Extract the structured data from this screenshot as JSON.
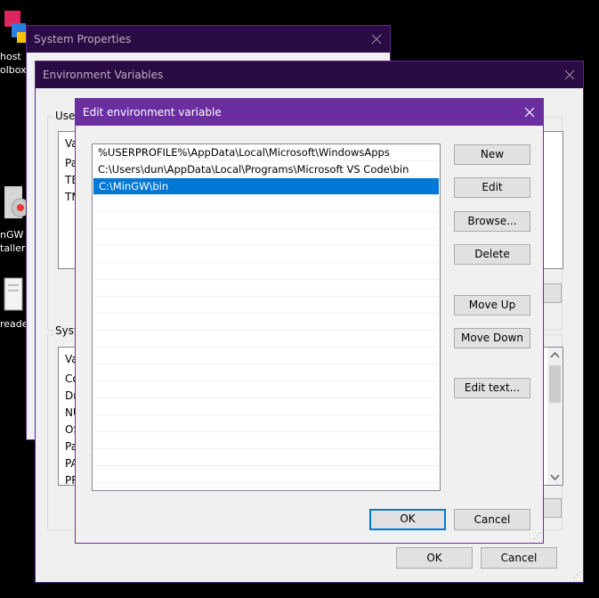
{
  "desktop": {
    "icons": [
      {
        "name": "ghost-toolbox",
        "lines": [
          "host",
          "olbox"
        ]
      },
      {
        "name": "mingw-installer",
        "lines": [
          "nGW",
          "taller"
        ]
      },
      {
        "name": "reader",
        "lines": [
          "reader"
        ]
      }
    ]
  },
  "system_properties": {
    "title": "System Properties"
  },
  "env_vars": {
    "title": "Environment Variables",
    "user_group_label": "User",
    "user_rows": [
      "Va",
      "Pa",
      "TE",
      "TM"
    ],
    "system_group_label": "Syste",
    "system_rows": [
      "Va",
      "Co",
      "Dr",
      "NU",
      "OS",
      "Pa",
      "PA",
      "PR"
    ],
    "ok_label": "OK",
    "cancel_label": "Cancel"
  },
  "edit_dialog": {
    "title": "Edit environment variable",
    "paths": [
      "%USERPROFILE%\\AppData\\Local\\Microsoft\\WindowsApps",
      "C:\\Users\\dun\\AppData\\Local\\Programs\\Microsoft VS Code\\bin",
      "C:\\MinGW\\bin"
    ],
    "selected_index": 2,
    "buttons": {
      "new": "New",
      "edit": "Edit",
      "browse": "Browse...",
      "delete": "Delete",
      "move_up": "Move Up",
      "move_down": "Move Down",
      "edit_text": "Edit text..."
    },
    "ok_label": "OK",
    "cancel_label": "Cancel"
  },
  "colors": {
    "accent": "#0078d7",
    "title_active": "#6a2ea0",
    "title_inactive": "#2b0b44"
  }
}
